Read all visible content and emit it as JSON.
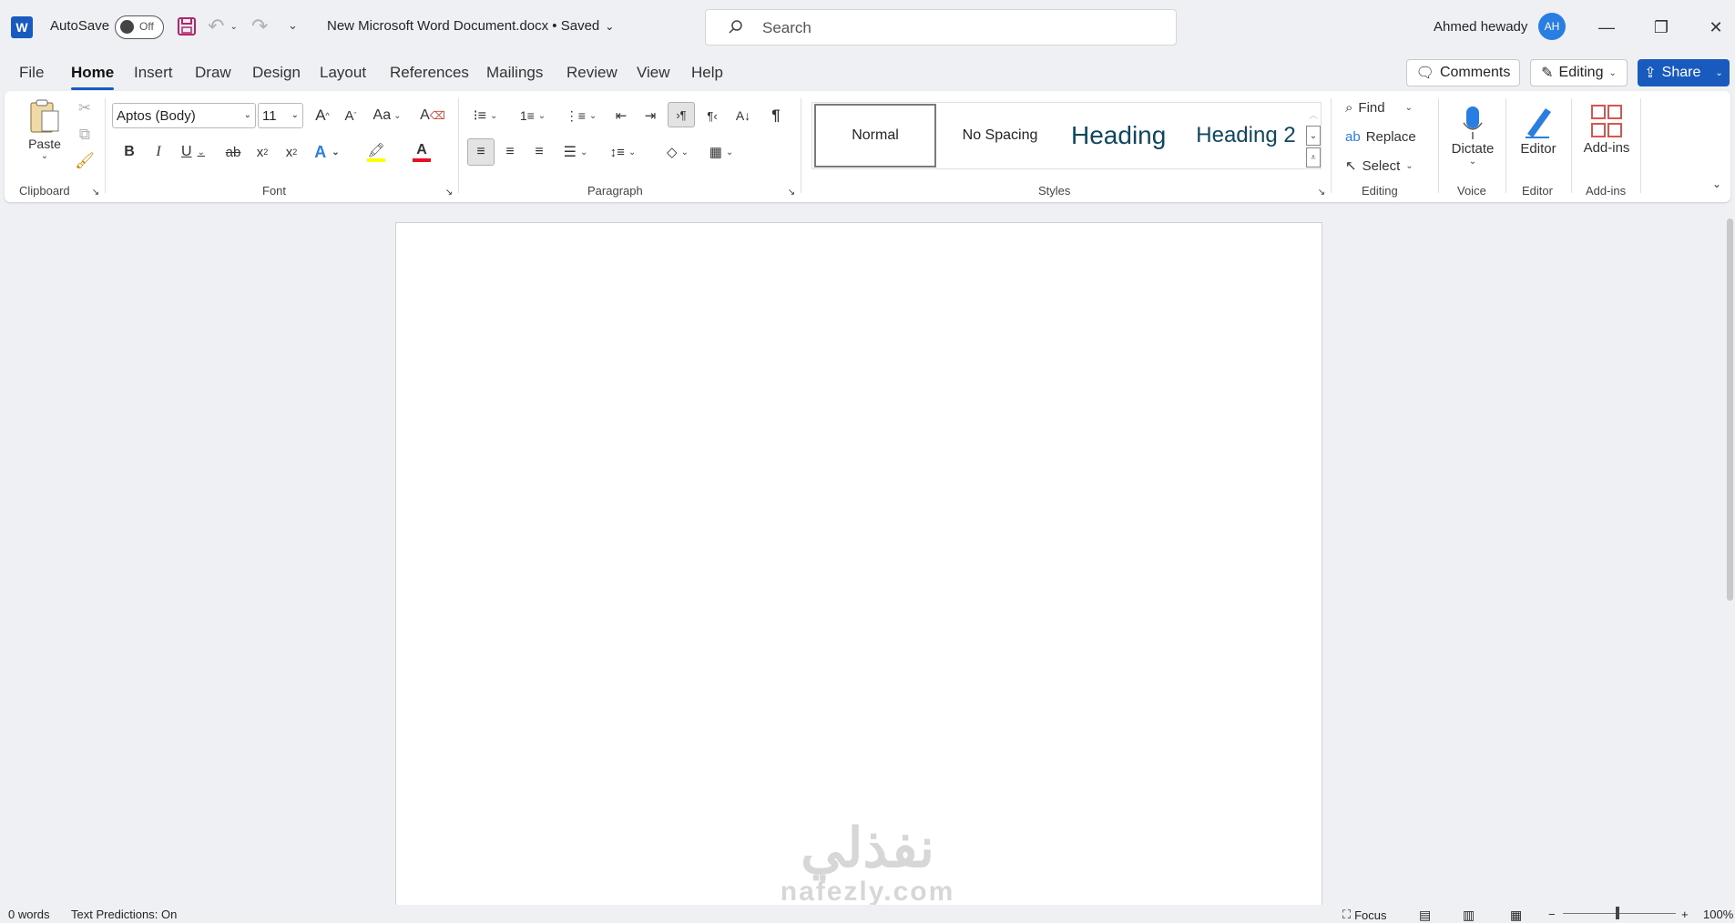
{
  "app": {
    "logo_letter": "W",
    "autosave_label": "AutoSave",
    "autosave_state": "Off",
    "doc_title": "New Microsoft Word Document.docx • Saved",
    "search_placeholder": "Search",
    "user_name": "Ahmed hewady",
    "user_initials": "AH"
  },
  "tabs": [
    "File",
    "Home",
    "Insert",
    "Draw",
    "Design",
    "Layout",
    "References",
    "Mailings",
    "Review",
    "View",
    "Help"
  ],
  "active_tab": "Home",
  "actions": {
    "comments": "Comments",
    "editing": "Editing",
    "share": "Share"
  },
  "ribbon": {
    "clipboard": {
      "paste": "Paste",
      "label": "Clipboard"
    },
    "font": {
      "name": "Aptos (Body)",
      "size": "11",
      "case_btn": "Aa",
      "label": "Font"
    },
    "paragraph": {
      "label": "Paragraph"
    },
    "styles": {
      "items": [
        "Normal",
        "No Spacing",
        "Heading 1",
        "Heading 2"
      ],
      "label": "Styles"
    },
    "editing": {
      "find": "Find",
      "replace": "Replace",
      "select": "Select",
      "label": "Editing"
    },
    "voice": {
      "dictate": "Dictate",
      "label": "Voice"
    },
    "editor": {
      "editor": "Editor",
      "label": "Editor"
    },
    "addins": {
      "addins": "Add-ins",
      "label": "Add-ins"
    }
  },
  "colors": {
    "accent": "#185abd",
    "highlight": "#ffff00",
    "font_color": "#e81123"
  },
  "watermark": {
    "arabic": "نفذلي",
    "latin": "nafezly.com"
  },
  "status": {
    "words": "0 words",
    "predictions": "Text Predictions: On",
    "focus": "Focus",
    "zoom": "100%"
  }
}
